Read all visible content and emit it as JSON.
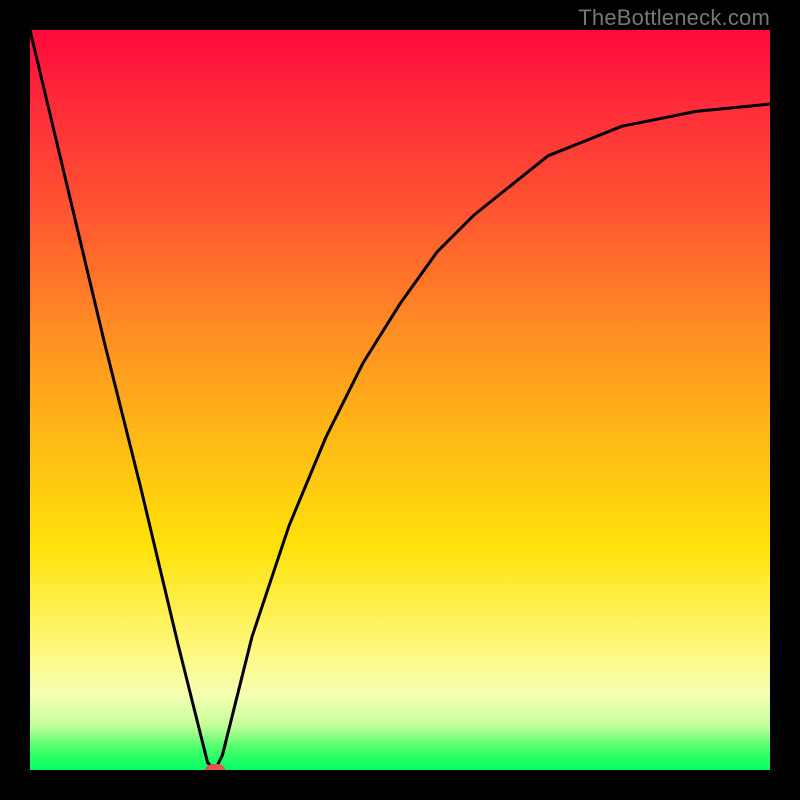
{
  "attribution": "TheBottleneck.com",
  "chart_data": {
    "type": "line",
    "title": "",
    "xlabel": "",
    "ylabel": "",
    "xlim": [
      0,
      100
    ],
    "ylim": [
      0,
      100
    ],
    "curve": {
      "x": [
        0,
        5,
        10,
        15,
        20,
        24,
        25,
        26,
        30,
        35,
        40,
        45,
        50,
        55,
        60,
        65,
        70,
        75,
        80,
        85,
        90,
        95,
        100
      ],
      "y": [
        100,
        79,
        58,
        38,
        17,
        1,
        0,
        2,
        18,
        33,
        45,
        55,
        63,
        70,
        75,
        79,
        83,
        85,
        87,
        88,
        89,
        89.5,
        90
      ]
    },
    "marker": {
      "x": 25,
      "y": 0
    },
    "gradient_stops": [
      {
        "pos": 0,
        "color": "#ff0a3c"
      },
      {
        "pos": 25,
        "color": "#ff5630"
      },
      {
        "pos": 55,
        "color": "#ffb916"
      },
      {
        "pos": 82,
        "color": "#fff66e"
      },
      {
        "pos": 100,
        "color": "#00ff63"
      }
    ]
  }
}
